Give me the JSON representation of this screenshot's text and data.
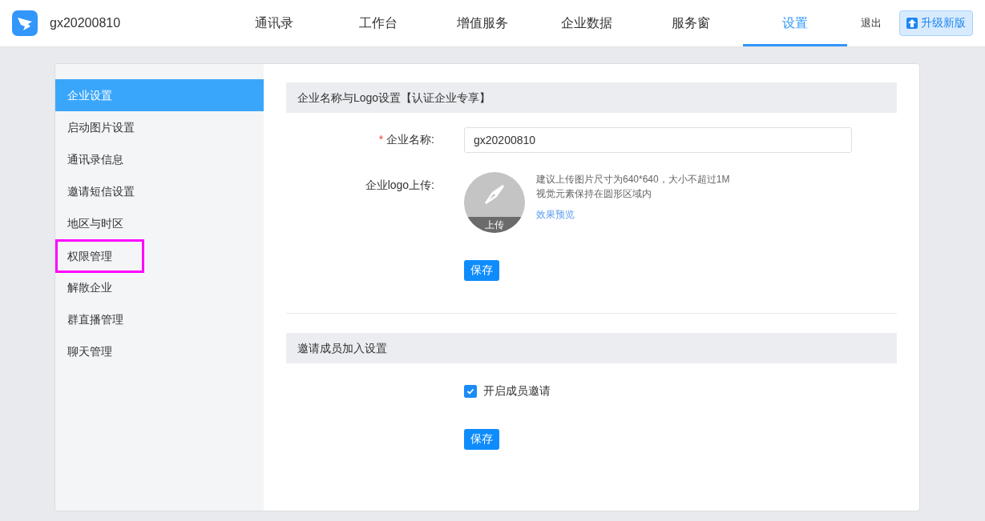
{
  "header": {
    "org": "gx20200810",
    "nav": [
      {
        "label": "通讯录",
        "selected": false
      },
      {
        "label": "工作台",
        "selected": false
      },
      {
        "label": "增值服务",
        "selected": false
      },
      {
        "label": "企业数据",
        "selected": false
      },
      {
        "label": "服务窗",
        "selected": false
      },
      {
        "label": "设置",
        "selected": true
      }
    ],
    "logout": "退出",
    "upgrade": "升级新版"
  },
  "sidebar": {
    "items": [
      {
        "label": "企业设置",
        "selected": true,
        "highlighted": false
      },
      {
        "label": "启动图片设置",
        "selected": false,
        "highlighted": false
      },
      {
        "label": "通讯录信息",
        "selected": false,
        "highlighted": false
      },
      {
        "label": "邀请短信设置",
        "selected": false,
        "highlighted": false
      },
      {
        "label": "地区与时区",
        "selected": false,
        "highlighted": false
      },
      {
        "label": "权限管理",
        "selected": false,
        "highlighted": true
      },
      {
        "label": "解散企业",
        "selected": false,
        "highlighted": false
      },
      {
        "label": "群直播管理",
        "selected": false,
        "highlighted": false
      },
      {
        "label": "聊天管理",
        "selected": false,
        "highlighted": false
      }
    ]
  },
  "name_section": {
    "title": "企业名称与Logo设置【认证企业专享】",
    "required_mark": "*",
    "name_label": "企业名称:",
    "name_value": "gx20200810",
    "logo_label": "企业logo上传:",
    "upload": "上传",
    "hint_lines": [
      "建议上传图片尺寸为640*640，大小不超过1M",
      "视觉元素保持在圆形区域内"
    ],
    "preview_link": "效果预览",
    "save": "保存"
  },
  "invite_section": {
    "title": "邀请成员加入设置",
    "checkbox": {
      "label": "开启成员邀请",
      "checked": true
    },
    "save": "保存"
  }
}
